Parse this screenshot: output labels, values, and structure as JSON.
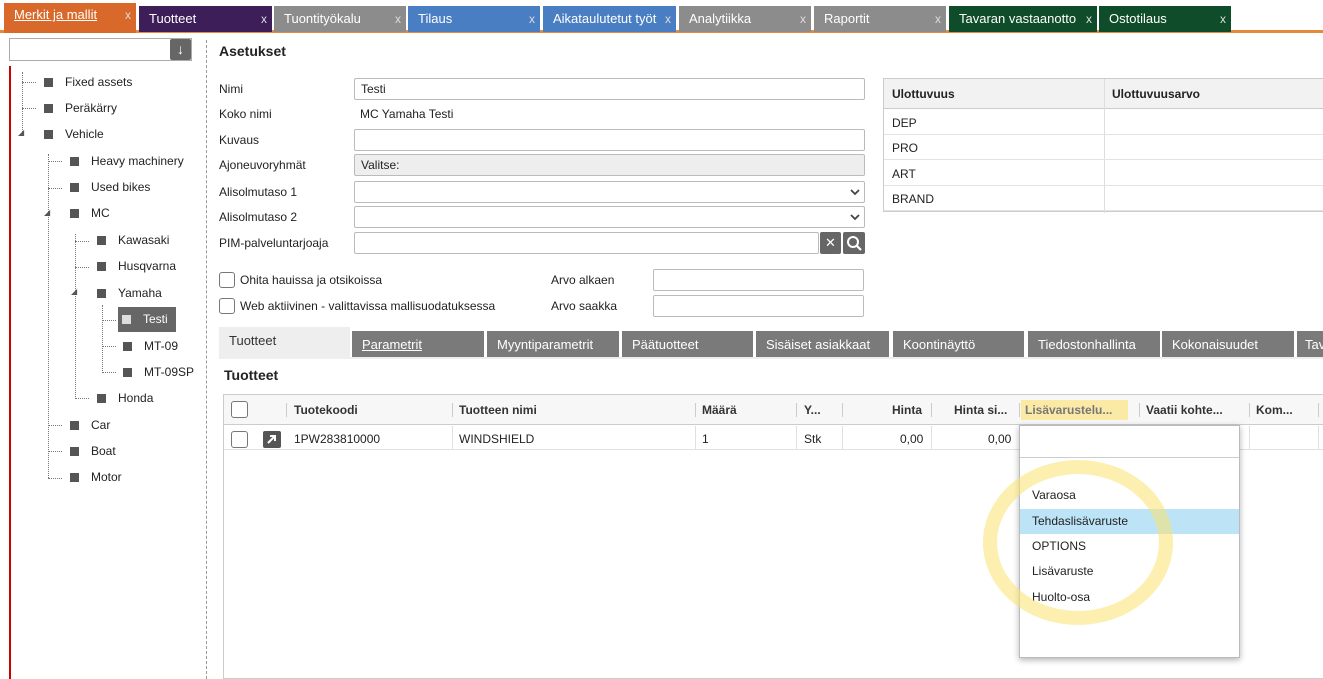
{
  "top_tabs": [
    {
      "label": "Merkit ja mallit",
      "color": "#d9692b"
    },
    {
      "label": "Tuotteet",
      "color": "#3d1e58"
    },
    {
      "label": "Tuontityökalu",
      "color": "#8c8c8c"
    },
    {
      "label": "Tilaus",
      "color": "#4a7ec3"
    },
    {
      "label": "Aikataulutetut työt",
      "color": "#4a7ec3"
    },
    {
      "label": "Analytiikka",
      "color": "#8c8c8c"
    },
    {
      "label": "Raportit",
      "color": "#8c8c8c"
    },
    {
      "label": "Tavaran vastaanotto",
      "color": "#0f4d2a"
    },
    {
      "label": "Ostotilaus",
      "color": "#0f4d2a"
    }
  ],
  "tab_close": "x",
  "tree": {
    "search_button": "↓",
    "nodes": [
      "Fixed assets",
      "Peräkärry",
      "Vehicle",
      "Heavy machinery",
      "Used bikes",
      "MC",
      "Kawasaki",
      "Husqvarna",
      "Yamaha",
      "Testi",
      "MT-09",
      "MT-09SP",
      "Honda",
      "Car",
      "Boat",
      "Motor"
    ]
  },
  "settings": {
    "title": "Asetukset",
    "labels": {
      "name": "Nimi",
      "full_name": "Koko nimi",
      "description": "Kuvaus",
      "vehicle_groups": "Ajoneuvoryhmät",
      "subnode_level1": "Alisolmutaso 1",
      "subnode_level2": "Alisolmutaso 2",
      "pim_provider": "PIM-palveluntarjoaja",
      "value_from": "Arvo alkaen",
      "value_to": "Arvo saakka"
    },
    "values": {
      "name": "Testi",
      "full_name": "MC Yamaha Testi",
      "description": "",
      "vehicle_groups": "Valitse:",
      "subnode_level1": "",
      "subnode_level2": "",
      "pim_provider": "",
      "value_from": "",
      "value_to": ""
    },
    "checkboxes": {
      "skip_search": "Ohita hauissa ja otsikoissa",
      "web_active": "Web aktiivinen - valittavissa mallisuodatuksessa"
    },
    "pim_clear": "✕"
  },
  "dimensions": {
    "headers": [
      "Ulottuvuus",
      "Ulottuvuusarvo"
    ],
    "rows": [
      "DEP",
      "PRO",
      "ART",
      "BRAND"
    ]
  },
  "sub_tabs": [
    "Tuotteet",
    "Parametrit",
    "Myyntiparametrit",
    "Päätuotteet",
    "Sisäiset asiakkaat",
    "Koontinäyttö",
    "Tiedostonhallinta",
    "Kokonaisuudet",
    "Tav"
  ],
  "products": {
    "title": "Tuotteet",
    "columns": [
      "Tuotekoodi",
      "Tuotteen nimi",
      "Määrä",
      "Y...",
      "Hinta",
      "Hinta si...",
      "Lisävarustelu...",
      "Vaatii kohte...",
      "Kom..."
    ],
    "rows": [
      {
        "code": "1PW283810000",
        "name": "WINDSHIELD",
        "qty": "1",
        "unit": "Stk",
        "price": "0,00",
        "price2": "0,00"
      }
    ]
  },
  "dropdown": {
    "items": [
      "Varaosa",
      "Tehdaslisävaruste",
      "OPTIONS",
      "Lisävaruste",
      "Huolto-osa"
    ],
    "highlighted_index": 1
  }
}
